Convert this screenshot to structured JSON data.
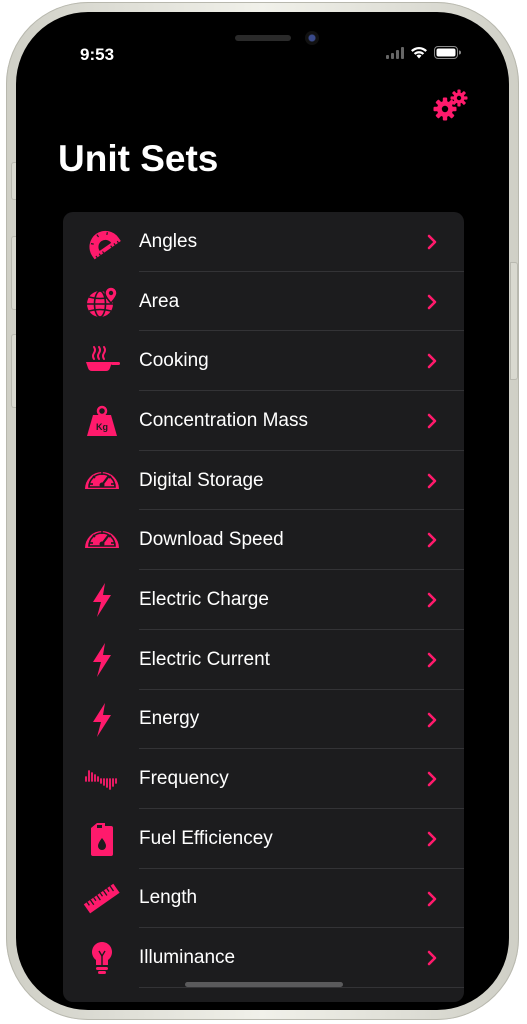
{
  "status_bar": {
    "time": "9:53"
  },
  "header": {
    "title": "Unit Sets"
  },
  "accent_color": "#ff1a6c",
  "list": {
    "items": [
      {
        "label": "Angles",
        "icon": "protractor-icon"
      },
      {
        "label": "Area",
        "icon": "globe-pin-icon"
      },
      {
        "label": "Cooking",
        "icon": "frying-pan-icon"
      },
      {
        "label": "Concentration Mass",
        "icon": "kg-weight-icon",
        "icon_text": "Kg"
      },
      {
        "label": "Digital Storage",
        "icon": "speedometer-icon"
      },
      {
        "label": "Download Speed",
        "icon": "speedometer-icon"
      },
      {
        "label": "Electric Charge",
        "icon": "lightning-bolt-icon"
      },
      {
        "label": "Electric Current",
        "icon": "lightning-bolt-icon"
      },
      {
        "label": "Energy",
        "icon": "lightning-bolt-icon"
      },
      {
        "label": "Frequency",
        "icon": "waveform-icon"
      },
      {
        "label": "Fuel Efficiencey",
        "icon": "fuel-can-icon"
      },
      {
        "label": "Length",
        "icon": "ruler-icon"
      },
      {
        "label": "Illuminance",
        "icon": "light-bulb-icon"
      }
    ]
  }
}
